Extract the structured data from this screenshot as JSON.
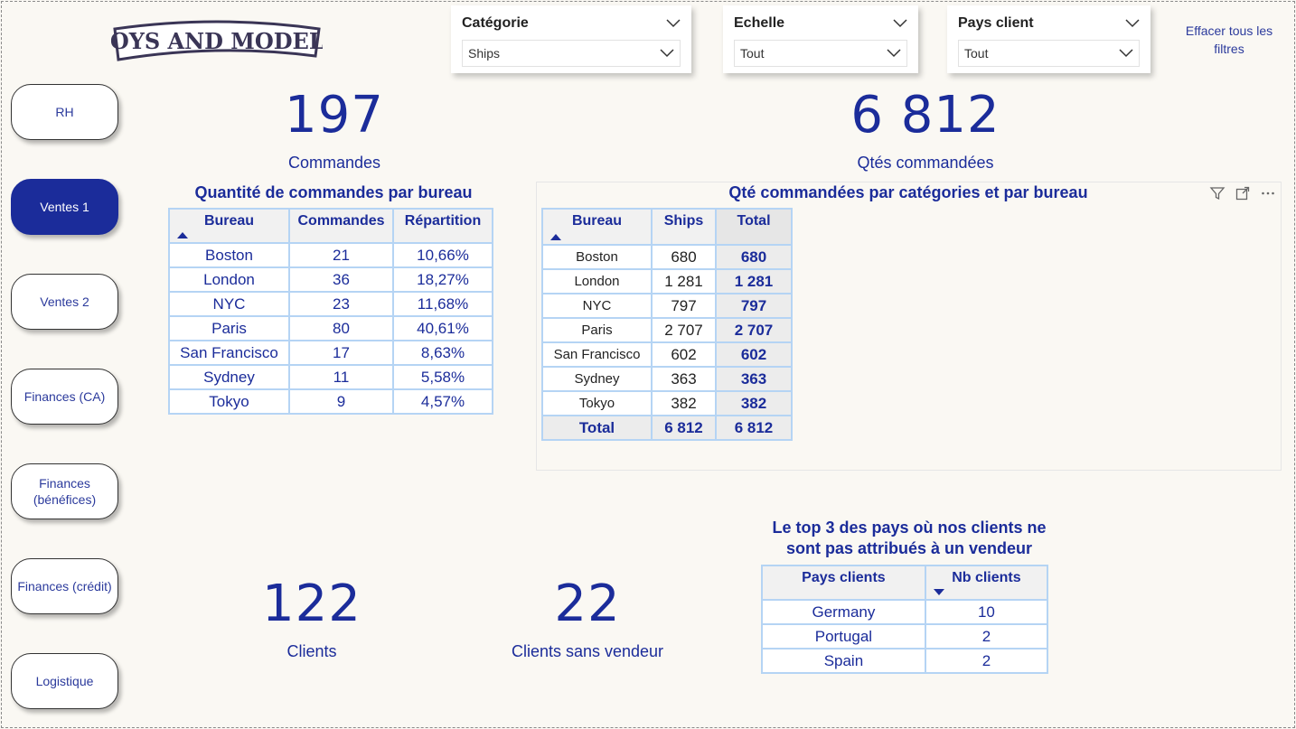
{
  "logo_text": "TOYS AND MODELS",
  "nav": {
    "items": [
      {
        "label": "RH"
      },
      {
        "label": "Ventes 1"
      },
      {
        "label": "Ventes 2"
      },
      {
        "label": "Finances (CA)"
      },
      {
        "label": "Finances\n(bénéfices)"
      },
      {
        "label": "Finances (crédit)"
      },
      {
        "label": "Logistique"
      }
    ],
    "active": "Ventes 1"
  },
  "slicers": [
    {
      "title": "Catégorie",
      "value": "Ships"
    },
    {
      "title": "Echelle",
      "value": "Tout"
    },
    {
      "title": "Pays client",
      "value": "Tout"
    }
  ],
  "clear_filters_label": "Effacer tous les filtres",
  "kpis": {
    "orders": {
      "value": "197",
      "label": "Commandes"
    },
    "qty": {
      "value": "6 812",
      "label": "Qtés commandées"
    },
    "clients": {
      "value": "122",
      "label": "Clients"
    },
    "no_seller": {
      "value": "22",
      "label": "Clients sans vendeur"
    }
  },
  "orders_table": {
    "title": "Quantité de commandes par bureau",
    "headers": [
      "Bureau",
      "Commandes",
      "Répartition"
    ],
    "rows": [
      [
        "Boston",
        "21",
        "10,66%"
      ],
      [
        "London",
        "36",
        "18,27%"
      ],
      [
        "NYC",
        "23",
        "11,68%"
      ],
      [
        "Paris",
        "80",
        "40,61%"
      ],
      [
        "San Francisco",
        "17",
        "8,63%"
      ],
      [
        "Sydney",
        "11",
        "5,58%"
      ],
      [
        "Tokyo",
        "9",
        "4,57%"
      ]
    ]
  },
  "matrix": {
    "title": "Qté commandées par catégories et par bureau",
    "headers": [
      "Bureau",
      "Ships",
      "Total"
    ],
    "rows": [
      [
        "Boston",
        "680",
        "680"
      ],
      [
        "London",
        "1 281",
        "1 281"
      ],
      [
        "NYC",
        "797",
        "797"
      ],
      [
        "Paris",
        "2 707",
        "2 707"
      ],
      [
        "San Francisco",
        "602",
        "602"
      ],
      [
        "Sydney",
        "363",
        "363"
      ],
      [
        "Tokyo",
        "382",
        "382"
      ]
    ],
    "total_row": [
      "Total",
      "6 812",
      "6 812"
    ]
  },
  "top3": {
    "title": "Le top 3 des pays où nos clients ne sont pas attribués à un vendeur",
    "headers": [
      "Pays clients",
      "Nb clients"
    ],
    "rows": [
      [
        "Germany",
        "10"
      ],
      [
        "Portugal",
        "2"
      ],
      [
        "Spain",
        "2"
      ]
    ]
  },
  "colors": {
    "accent": "#1b2c9a",
    "background": "#faf8f3",
    "table_border": "#b5d4f4"
  }
}
